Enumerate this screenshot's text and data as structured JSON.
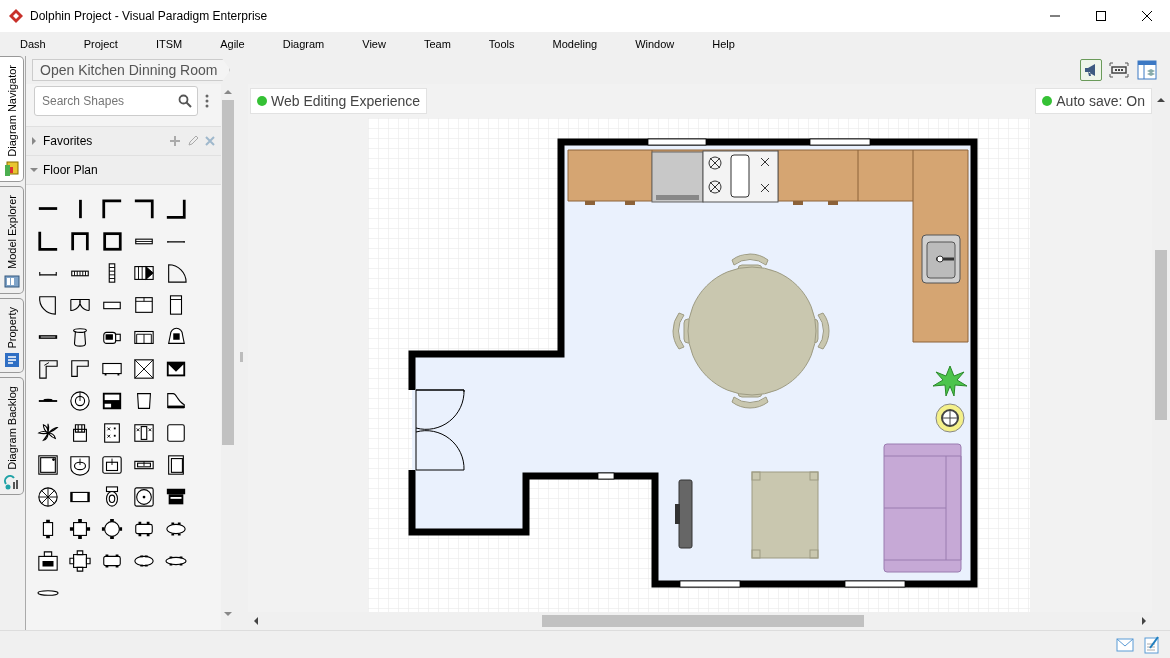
{
  "window": {
    "title": "Dolphin Project - Visual Paradigm Enterprise"
  },
  "menu": [
    "Dash",
    "Project",
    "ITSM",
    "Agile",
    "Diagram",
    "View",
    "Team",
    "Tools",
    "Modeling",
    "Window",
    "Help"
  ],
  "side_tabs": [
    {
      "label": "Diagram Navigator",
      "selected": true
    },
    {
      "label": "Model Explorer",
      "selected": false
    },
    {
      "label": "Property",
      "selected": false
    },
    {
      "label": "Diagram Backlog",
      "selected": false
    }
  ],
  "breadcrumb": "Open Kitchen Dinning Room",
  "palette": {
    "search": {
      "placeholder": "Search Shapes"
    },
    "groups": [
      {
        "label": "Favorites",
        "expanded": false
      },
      {
        "label": "Floor Plan",
        "expanded": true
      }
    ]
  },
  "canvas": {
    "badges": [
      {
        "label": "Web Editing Experience",
        "color": "#35c135"
      },
      {
        "label": "Auto save: On",
        "color": "#35c135"
      }
    ]
  }
}
